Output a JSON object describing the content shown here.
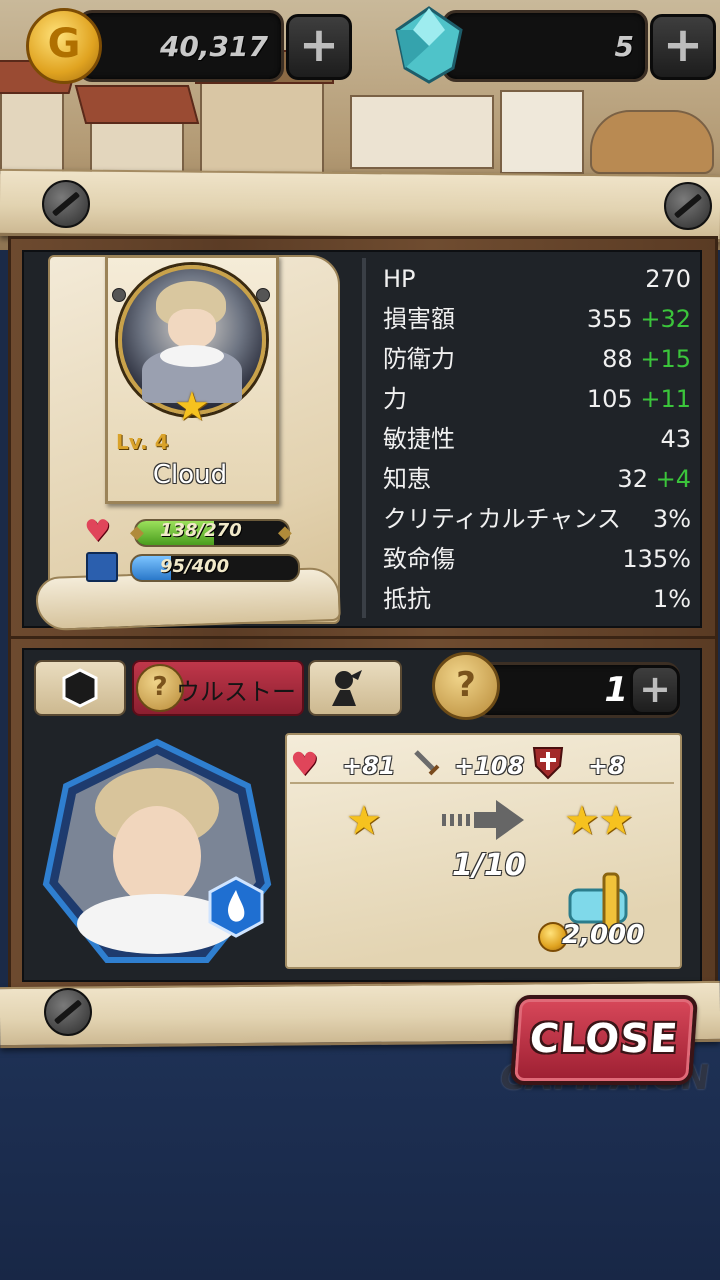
{
  "currency": {
    "gold": "40,317",
    "gems": "5",
    "gold_icon": "G"
  },
  "hero": {
    "name": "Cloud",
    "level": "Lv. 4",
    "hp_text": "138/270",
    "hp_fraction": 0.511,
    "xp_text": "95/400",
    "xp_fraction": 0.2375
  },
  "stats": [
    {
      "label": "HP",
      "value": "270",
      "bonus": ""
    },
    {
      "label": "損害額",
      "value": "355",
      "bonus": "+32"
    },
    {
      "label": "防衛力",
      "value": "88",
      "bonus": "+15"
    },
    {
      "label": "力",
      "value": "105",
      "bonus": "+11"
    },
    {
      "label": "敏捷性",
      "value": "43",
      "bonus": ""
    },
    {
      "label": "知恵",
      "value": "32",
      "bonus": "+4"
    },
    {
      "label": "クリティカルチャンス",
      "value": "3%",
      "bonus": ""
    },
    {
      "label": "致命傷",
      "value": "135%",
      "bonus": ""
    },
    {
      "label": "抵抗",
      "value": "1%",
      "bonus": ""
    }
  ],
  "tabs": {
    "active_label": "ウルストー"
  },
  "upgrade": {
    "token_count": "1",
    "hp_bonus": "+81",
    "attack_bonus": "+108",
    "defense_bonus": "+8",
    "progress": "1/10",
    "cost": "2,000"
  },
  "buttons": {
    "close": "CLOSE",
    "plus": "+"
  },
  "background": {
    "campaign_label": "CAMPAIGN"
  },
  "icons": [
    "gold-coin-icon",
    "gem-icon",
    "heart-icon",
    "xp-book-icon",
    "hexagon-icon",
    "lock-icon",
    "knight-icon",
    "sword-icon",
    "shield-icon",
    "star-icon",
    "arrow-right-icon",
    "hammer-icon",
    "water-element-icon"
  ]
}
